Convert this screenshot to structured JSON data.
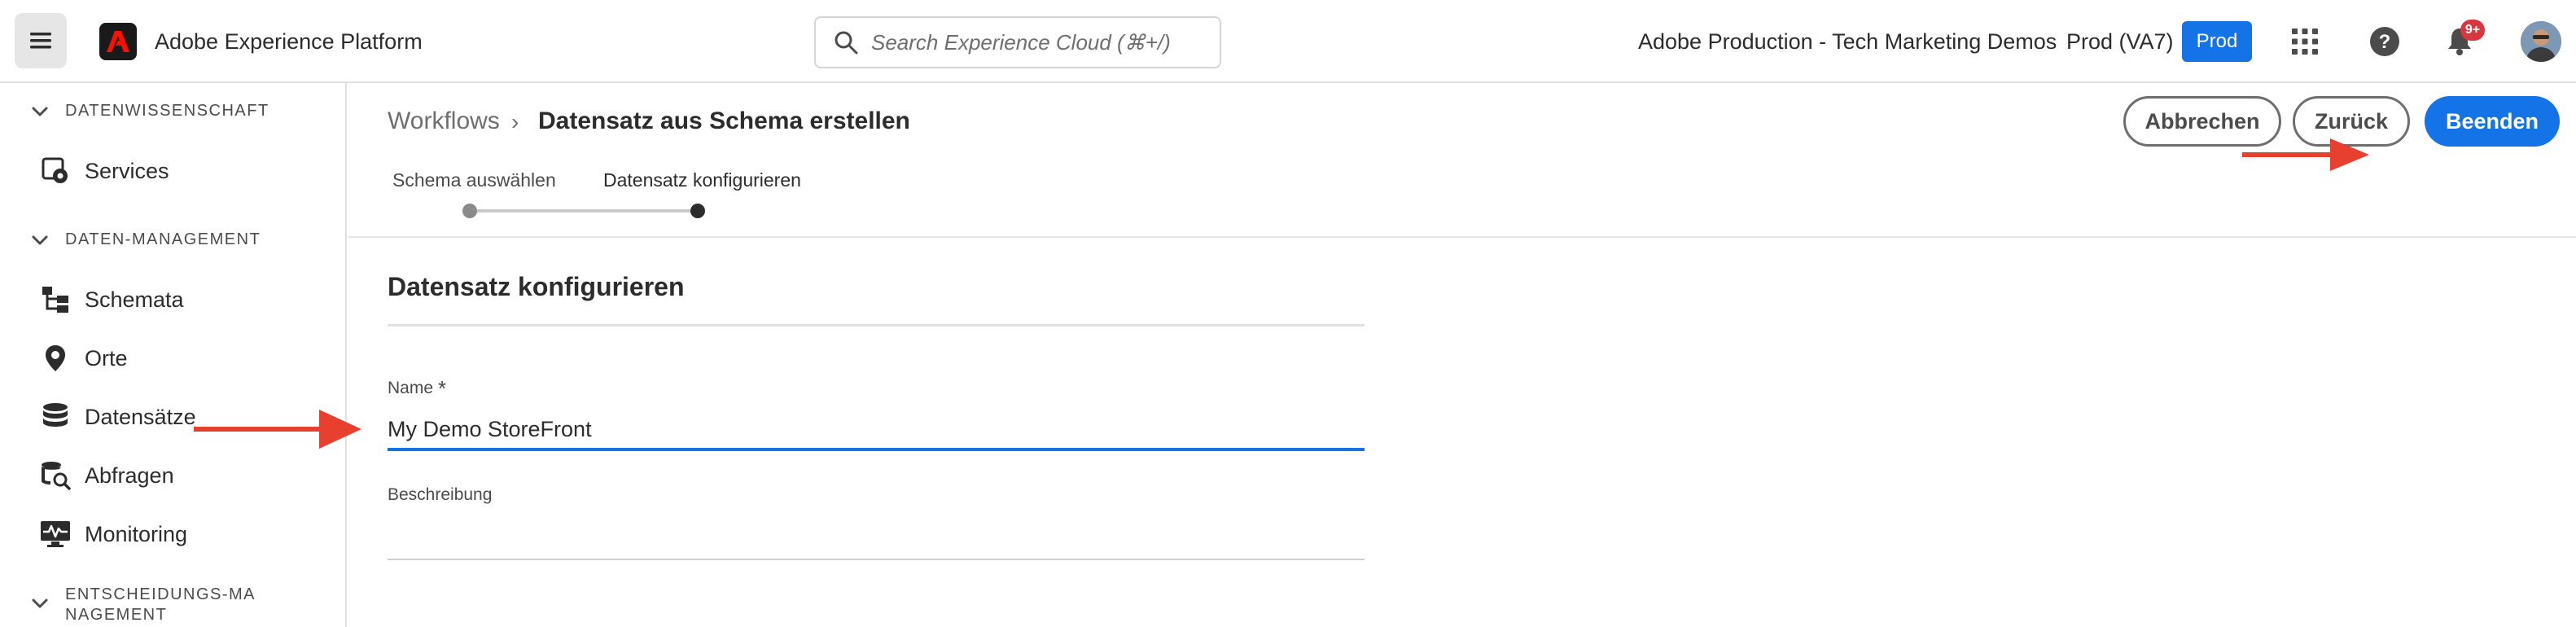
{
  "topbar": {
    "app_title": "Adobe Experience Platform",
    "search_placeholder": "Search Experience Cloud (⌘+/)",
    "org_name": "Adobe Production - Tech Marketing Demos",
    "sandbox_name": "Prod (VA7)",
    "sandbox_badge": "Prod",
    "notification_count": "9+"
  },
  "sidebar": {
    "sections": [
      {
        "label": "DATENWISSENSCHAFT"
      },
      {
        "label": "DATEN-MANAGEMENT"
      },
      {
        "label": "ENTSCHEIDUNGS-MANAGEMENT"
      }
    ],
    "items": [
      {
        "label": "Services",
        "icon": "services-icon"
      },
      {
        "label": "Schemata",
        "icon": "schema-icon"
      },
      {
        "label": "Orte",
        "icon": "location-pin-icon"
      },
      {
        "label": "Datensätze",
        "icon": "database-icon"
      },
      {
        "label": "Abfragen",
        "icon": "query-icon"
      },
      {
        "label": "Monitoring",
        "icon": "monitoring-icon"
      }
    ]
  },
  "breadcrumb": {
    "root": "Workflows",
    "separator": "›",
    "current": "Datensatz aus Schema erstellen"
  },
  "steps": [
    {
      "label": "Schema auswählen",
      "state": "done"
    },
    {
      "label": "Datensatz konfigurieren",
      "state": "active"
    }
  ],
  "actions": {
    "cancel": "Abbrechen",
    "back": "Zurück",
    "finish": "Beenden"
  },
  "form": {
    "title": "Datensatz konfigurieren",
    "name_label": "Name",
    "required_marker": "*",
    "name_value": "My Demo StoreFront",
    "description_label": "Beschreibung",
    "description_value": ""
  },
  "colors": {
    "accent": "#1473e6",
    "annotation_arrow": "#e8402f",
    "notification": "#d7373f"
  }
}
